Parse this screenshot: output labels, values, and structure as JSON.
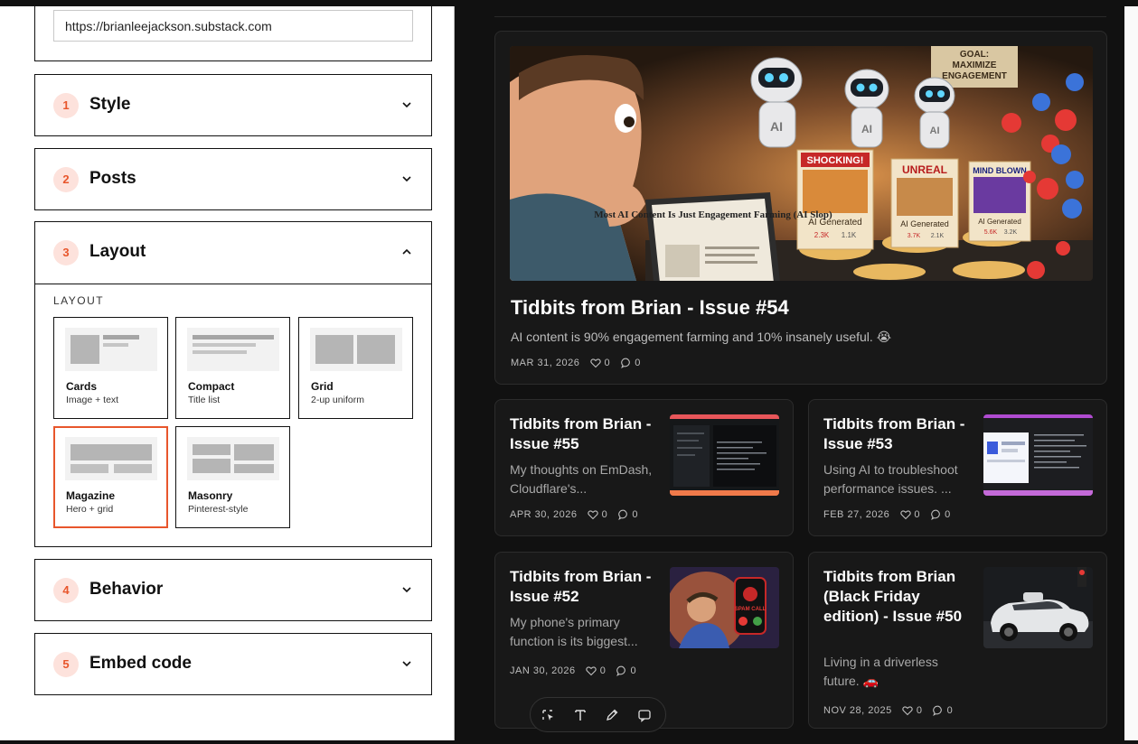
{
  "source": {
    "url": "https://brianleejackson.substack.com"
  },
  "sections": [
    {
      "number": "1",
      "title": "Style"
    },
    {
      "number": "2",
      "title": "Posts"
    },
    {
      "number": "3",
      "title": "Layout"
    },
    {
      "number": "4",
      "title": "Behavior"
    },
    {
      "number": "5",
      "title": "Embed code"
    }
  ],
  "layout": {
    "label": "LAYOUT",
    "selected": "Magazine",
    "options": [
      {
        "name": "Cards",
        "sub": "Image + text"
      },
      {
        "name": "Compact",
        "sub": "Title list"
      },
      {
        "name": "Grid",
        "sub": "2-up uniform"
      },
      {
        "name": "Magazine",
        "sub": "Hero + grid"
      },
      {
        "name": "Masonry",
        "sub": "Pinterest-style"
      }
    ]
  },
  "preview": {
    "hero": {
      "title": "Tidbits from Brian - Issue #54",
      "desc": "AI content is 90% engagement farming and 10% insanely useful. 😭",
      "date": "MAR 31, 2026",
      "likes": "0",
      "comments": "0",
      "image_text": {
        "goal": "GOAL: MAXIMIZE ENGAGEMENT",
        "laptop": "Most AI Content Is Just Engagement Farming (AI Slop)",
        "card1_head": "SHOCKING!",
        "card1_foot": "AI Generated",
        "card1_likes": "2.3K",
        "card1_comments": "1.1K",
        "card2_head": "UNREAL",
        "card2_foot": "AI Generated",
        "card2_likes": "3.7K",
        "card2_comments": "2.1K",
        "card3_head": "MIND BLOWN",
        "card3_foot": "AI Generated",
        "card3_likes": "5.6K",
        "card3_comments": "3.2K",
        "robot_label": "AI"
      }
    },
    "posts": [
      {
        "title": "Tidbits from Brian - Issue #55",
        "desc": "My thoughts on EmDash, Cloudflare's...",
        "date": "APR 30, 2026",
        "likes": "0",
        "comments": "0"
      },
      {
        "title": "Tidbits from Brian - Issue #53",
        "desc": "Using AI to troubleshoot performance issues. ...",
        "date": "FEB 27, 2026",
        "likes": "0",
        "comments": "0"
      },
      {
        "title": "Tidbits from Brian - Issue #52",
        "desc": "My phone's primary function is its biggest...",
        "date": "JAN 30, 2026",
        "likes": "0",
        "comments": "0",
        "image_text": "SPAM CALL"
      },
      {
        "title": "Tidbits from Brian (Black Friday edition) - Issue #50",
        "desc": "Living in a driverless future. 🚗",
        "date": "NOV 28, 2025",
        "likes": "0",
        "comments": "0"
      }
    ]
  },
  "toolbar": {
    "items": [
      "select-icon",
      "text-icon",
      "pen-icon",
      "comment-icon"
    ]
  },
  "colors": {
    "accent": "#e8562c",
    "badge_bg": "#fde2dc",
    "preview_bg": "#111111",
    "card_bg": "#181818"
  }
}
